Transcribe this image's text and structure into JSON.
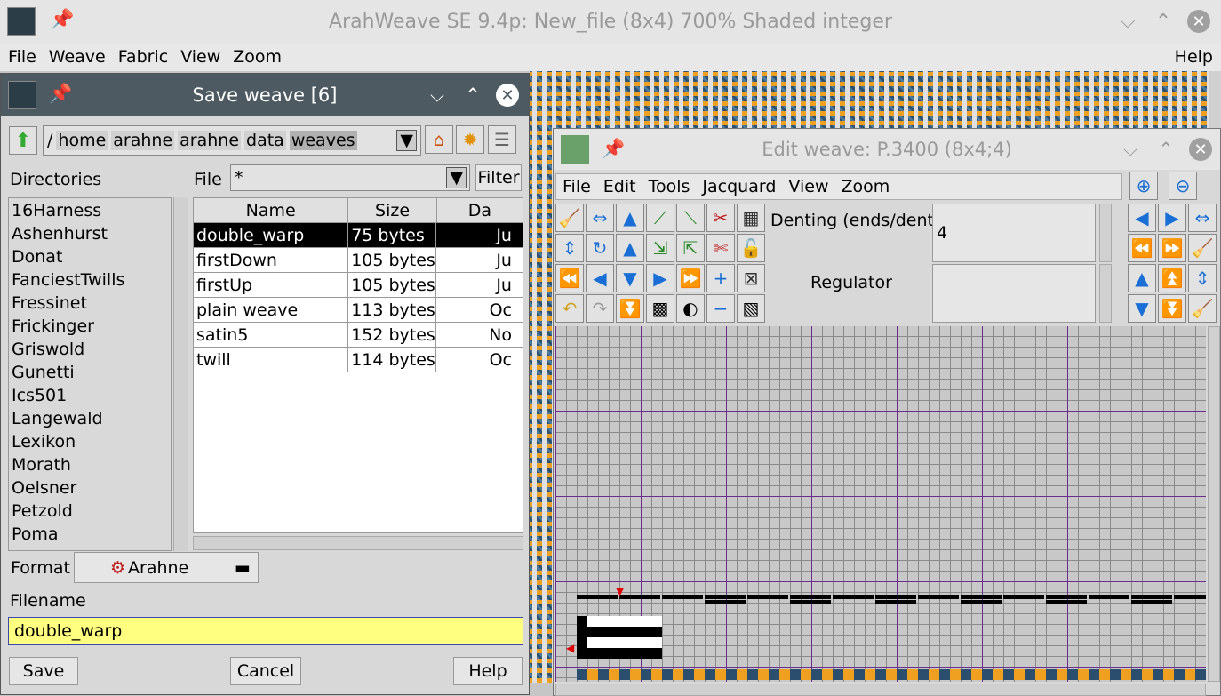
{
  "main": {
    "title": "ArahWeave SE 9.4p: New_file (8x4) 700% Shaded integer",
    "menu": [
      "File",
      "Weave",
      "Fabric",
      "View",
      "Zoom"
    ],
    "help": "Help"
  },
  "save": {
    "title": "Save weave [6]",
    "path": [
      "/",
      "home",
      "arahne",
      "arahne",
      "data",
      "weaves"
    ],
    "dirs_label": "Directories",
    "file_label": "File",
    "filter_value": "*",
    "filter_btn": "Filter",
    "dirs": [
      "16Harness",
      "Ashenhurst",
      "Donat",
      "FanciestTwills",
      "Fressinet",
      "Frickinger",
      "Griswold",
      "Gunetti",
      "Ics501",
      "Langewald",
      "Lexikon",
      "Morath",
      "Oelsner",
      "Petzold",
      "Poma"
    ],
    "cols": [
      "Name",
      "Size",
      "Da"
    ],
    "files": [
      {
        "name": "double_warp",
        "size": "75 bytes",
        "date": "Ju"
      },
      {
        "name": "firstDown",
        "size": "105 bytes",
        "date": "Ju"
      },
      {
        "name": "firstUp",
        "size": "105 bytes",
        "date": "Ju"
      },
      {
        "name": "plain weave",
        "size": "113 bytes",
        "date": "Oc"
      },
      {
        "name": "satin5",
        "size": "152 bytes",
        "date": "No"
      },
      {
        "name": "twill",
        "size": "114 bytes",
        "date": "Oc"
      }
    ],
    "format_label": "Format",
    "format_value": "Arahne",
    "filename_label": "Filename",
    "filename": "double_warp",
    "btn_save": "Save",
    "btn_cancel": "Cancel",
    "btn_help": "Help"
  },
  "edit": {
    "title": "Edit weave: P.3400 (8x4;4)",
    "menu": [
      "File",
      "Edit",
      "Tools",
      "Jacquard",
      "View",
      "Zoom"
    ],
    "denting_label": "Denting (ends/dent)",
    "denting_value": "4",
    "regulator_label": "Regulator"
  },
  "colors": {
    "selection": "#000000",
    "filename_bg": "#ffff80",
    "accent": "#1a6fd6"
  }
}
